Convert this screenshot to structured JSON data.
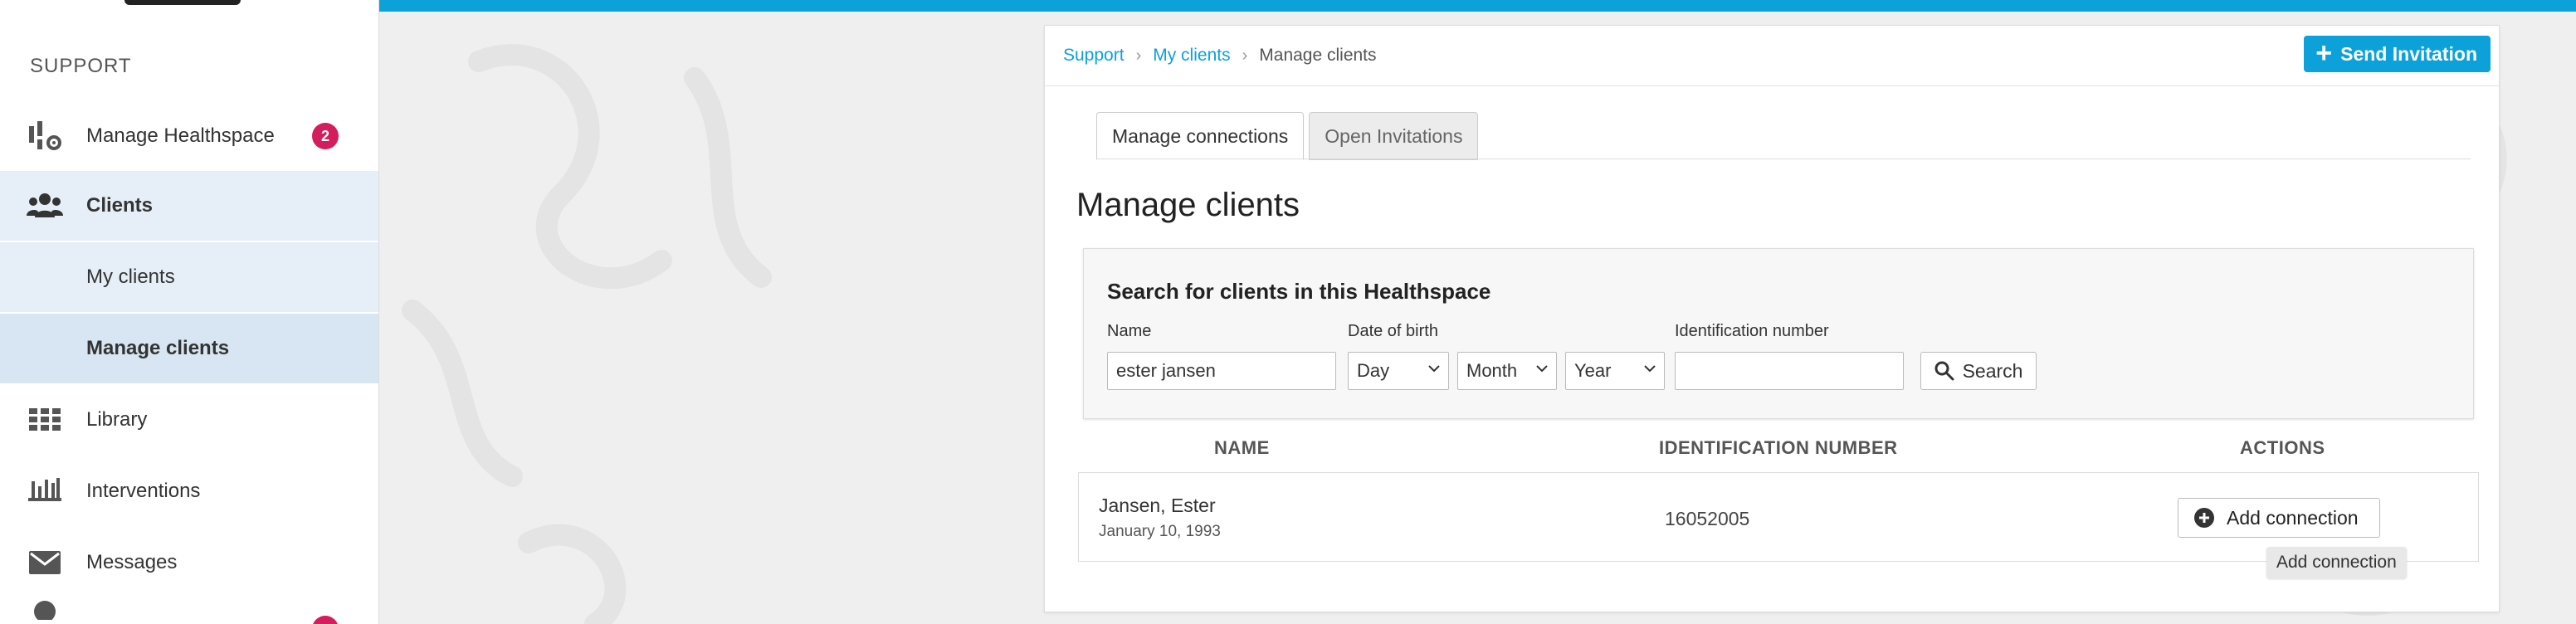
{
  "sidebar": {
    "section_title": "SUPPORT",
    "items": [
      {
        "label": "Manage Healthspace",
        "icon": "healthspace-settings-icon",
        "badge": "2"
      },
      {
        "label": "Clients",
        "icon": "users-icon"
      },
      {
        "label": "My clients"
      },
      {
        "label": "Manage clients"
      },
      {
        "label": "Library",
        "icon": "grid-icon"
      },
      {
        "label": "Interventions",
        "icon": "interventions-icon"
      },
      {
        "label": "Messages",
        "icon": "envelope-icon"
      }
    ]
  },
  "breadcrumb": {
    "items": [
      "Support",
      "My clients",
      "Manage clients"
    ]
  },
  "header": {
    "send_invitation_label": "Send Invitation"
  },
  "tabs": [
    {
      "label": "Manage connections",
      "active": true
    },
    {
      "label": "Open Invitations",
      "active": false
    }
  ],
  "page_title": "Manage clients",
  "search": {
    "title": "Search for clients in this Healthspace",
    "name_label": "Name",
    "name_value": "ester jansen",
    "dob_label": "Date of birth",
    "day_value": "Day",
    "month_value": "Month",
    "year_value": "Year",
    "id_label": "Identification number",
    "id_value": "",
    "button_label": "Search"
  },
  "table": {
    "columns": [
      "NAME",
      "IDENTIFICATION NUMBER",
      "ACTIONS"
    ],
    "rows": [
      {
        "name": "Jansen, Ester",
        "dob": "January 10, 1993",
        "id": "16052005",
        "action_label": "Add connection"
      }
    ]
  },
  "tooltip": "Add connection",
  "colors": {
    "accent": "#0da1d9",
    "badge": "#d41d5c",
    "sidebar_selected": "#d7e6f2"
  }
}
